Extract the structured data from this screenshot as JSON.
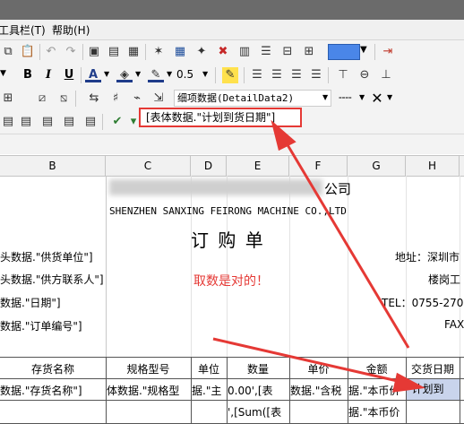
{
  "menu": {
    "toolbar_label": "工具栏(T)",
    "help_label": "帮助(H)"
  },
  "toolbar2": {
    "line_width": "0.5"
  },
  "toolbar3": {
    "detail_select": "细项数据(DetailData2)"
  },
  "formula": {
    "expression": "[表体数据.\"计划到货日期\"]"
  },
  "columns": [
    "B",
    "C",
    "D",
    "E",
    "F",
    "G",
    "H"
  ],
  "sheet": {
    "company_suffix": "公司",
    "company_en": "SHENZHEN SANXING FEIRONG MACHINE CO.,LTD",
    "doc_title": "订 购 单",
    "supplier": "头数据.\"供货单位\"]",
    "contact": "头数据.\"供方联系人\"]",
    "date": "数据.\"日期\"]",
    "order_no": "数据.\"订单编号\"]",
    "address": "地址：深圳市",
    "address2": "楼岗工",
    "tel": "TEL：0755-270",
    "fax": "FAX",
    "header_row": [
      "存货名称",
      "规格型号",
      "单位",
      "数量",
      "单价",
      "金额",
      "交货日期"
    ],
    "data_row": [
      "数据.\"存货名称\"]",
      "体数据.\"规格型",
      "据.\"主",
      "0.00',[表",
      "数据.\"含税",
      "据.\"本币价",
      "\"计划到"
    ],
    "data_row2": [
      "",
      "",
      "",
      "',[Sum([表",
      "",
      "据.\"本币价",
      ""
    ]
  },
  "annotation": {
    "text": "取数是对的！"
  },
  "colors": {
    "accent_red": "#e53935",
    "annotation_red": "#e53935"
  }
}
